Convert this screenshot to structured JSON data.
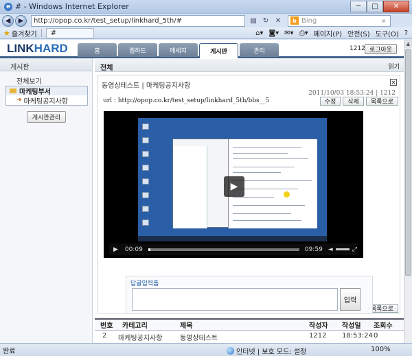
{
  "window": {
    "title": "# - Windows Internet Explorer",
    "min": "─",
    "max": "□",
    "close": "✕"
  },
  "address": {
    "url": "http://opop.co.kr/test_setup/linkhard_5th/#",
    "search_placeholder": "Bing",
    "back": "◀",
    "fwd": "▶"
  },
  "favorites": {
    "label": "즐겨찾기",
    "tab": "#",
    "page": "페이지(P)",
    "safety": "안전(S)",
    "tools": "도구(O)",
    "help": "?"
  },
  "site": {
    "logo_a": "LINK",
    "logo_b": "HARD",
    "tabs": [
      "홈",
      "웹하드",
      "메세지",
      "게시판",
      "관리"
    ],
    "active_tab": "게시판",
    "user_id": "1212",
    "logout": "로그아웃"
  },
  "sidebar": {
    "header": "게시판",
    "all": "전체보기",
    "folder": "마케팅부서",
    "sub": "마케팅공지사항",
    "admin": "게시판관리"
  },
  "main": {
    "header": "전체",
    "read_label": "읽기"
  },
  "post": {
    "title": "동영상테스트 | 마케팅공지사항",
    "meta": "2011/10/03 18:53:24 | 1212",
    "url_label": "url : http://opop.co.kr/test_setup/linkhard_5th/bbs__5",
    "buttons": [
      "수정",
      "삭제",
      "목록으로"
    ],
    "video": {
      "time_current": "00:09",
      "time_total": "09:59",
      "progress": 0.015
    }
  },
  "reply": {
    "title": "답글입력폼",
    "submit": "입력"
  },
  "list": {
    "columns": [
      "번호",
      "카테고리",
      "제목",
      "작성자",
      "작성일",
      "조회수"
    ],
    "row": [
      "2",
      "마케팅공지사항",
      "동영상테스트",
      "1212",
      "18:53:24",
      "0"
    ]
  },
  "status": {
    "left": "완료",
    "zone": "인터넷 | 보호 모드: 설정",
    "zoom": "100%"
  }
}
